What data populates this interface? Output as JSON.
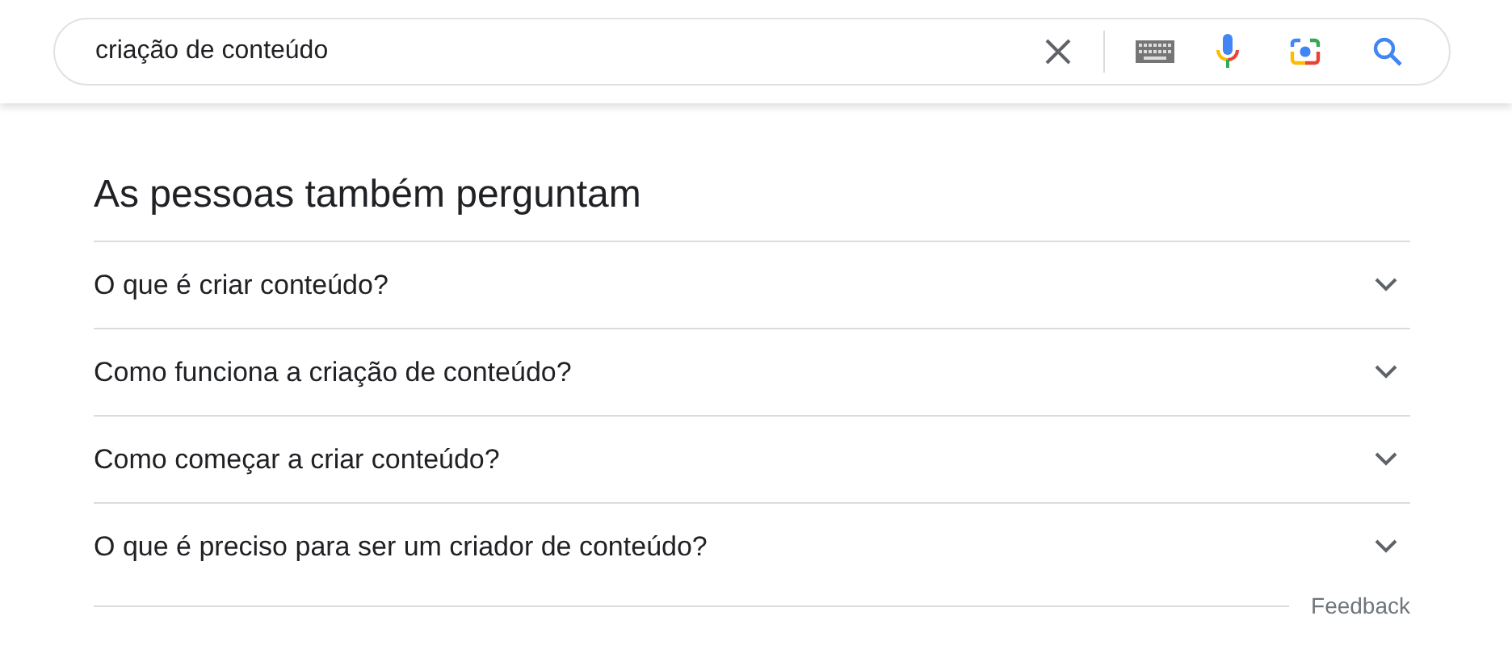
{
  "search": {
    "value": "criação de conteúdo"
  },
  "people_also_ask": {
    "title": "As pessoas também perguntam",
    "questions": [
      {
        "text": "O que é criar conteúdo?",
        "expanded": false
      },
      {
        "text": "Como funciona a criação de conteúdo?",
        "expanded": false
      },
      {
        "text": "Como começar a criar conteúdo?",
        "expanded": false
      },
      {
        "text": "O que é preciso para ser um criador de conteúdo?",
        "expanded": false
      }
    ],
    "feedback": "Feedback"
  }
}
